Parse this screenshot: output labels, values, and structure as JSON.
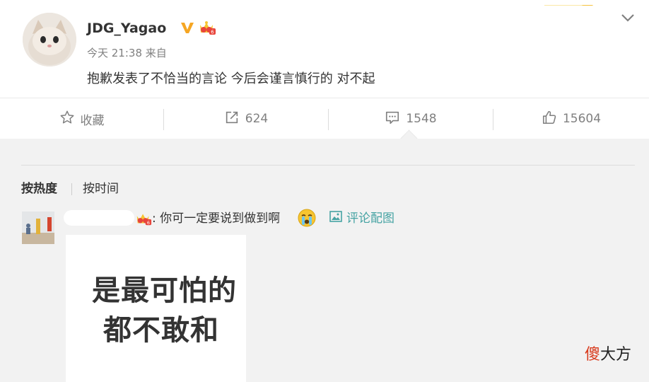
{
  "post": {
    "username": "JDG_Yagao",
    "time": "今天 21:38 来自",
    "text": "抱歉发表了不恰当的言论 今后会谨言慎行的 对不起"
  },
  "actions": {
    "favorite_label": "收藏",
    "repost_count": "624",
    "comment_count": "1548",
    "like_count": "15604"
  },
  "sort": {
    "hot": "按热度",
    "time": "按时间"
  },
  "comment": {
    "text": ": 你可一定要说到做到啊",
    "pic_label": "评论配图",
    "image_lines": [
      "是最可怕的",
      "都不敢和"
    ]
  },
  "watermark": {
    "first_char": "傻",
    "rest": "大方"
  },
  "colors": {
    "accent_link": "#46a3a3",
    "verified_badge": "#f5a623",
    "watermark_red": "#d83a1c"
  },
  "icons": [
    "star-icon",
    "repost-icon",
    "comment-icon",
    "thumbs-up-icon",
    "verified-badge-icon",
    "crown-icon",
    "crying-emoji-icon",
    "picture-icon",
    "chevron-down-icon"
  ]
}
